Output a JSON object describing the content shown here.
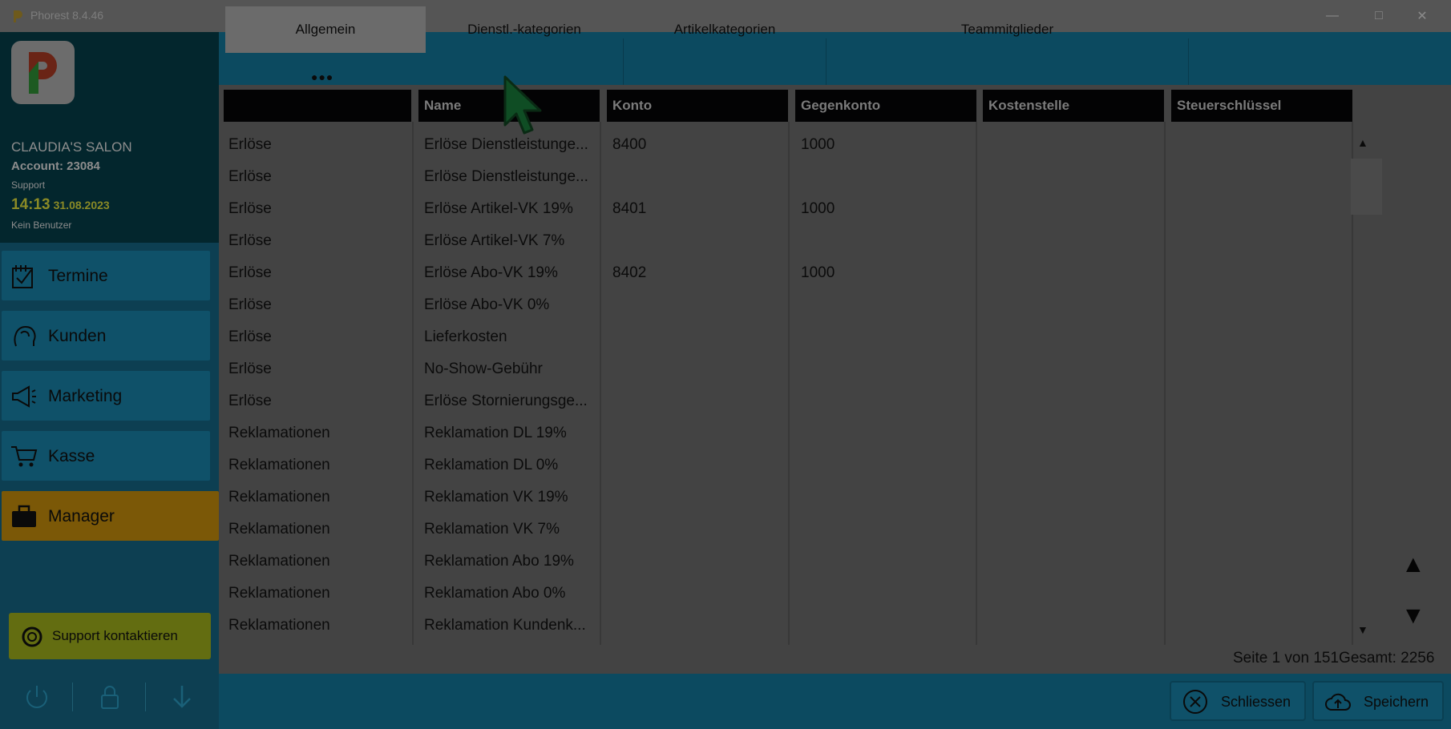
{
  "window": {
    "title": "Phorest 8.4.46"
  },
  "sidebar": {
    "salon_name": "CLAUDIA'S SALON",
    "account": "Account: 23084",
    "support_label": "Support",
    "time": "14:13",
    "date": "31.08.2023",
    "user": "Kein Benutzer",
    "nav": [
      {
        "label": "Termine",
        "icon": "calendar-icon"
      },
      {
        "label": "Kunden",
        "icon": "customer-head-icon"
      },
      {
        "label": "Marketing",
        "icon": "megaphone-icon"
      },
      {
        "label": "Kasse",
        "icon": "cart-icon"
      },
      {
        "label": "Manager",
        "icon": "briefcase-icon",
        "active": true
      }
    ],
    "support_button": "Support kontaktieren"
  },
  "tabs": [
    {
      "label": "Allgemein",
      "active": true
    },
    {
      "label": "Dienstl.-kategorien"
    },
    {
      "label": "Artikelkategorien"
    },
    {
      "label": "Teammitglieder"
    }
  ],
  "table": {
    "headers": [
      "",
      "Name",
      "Konto",
      "Gegenkonto",
      "Kostenstelle",
      "Steuerschlüssel"
    ],
    "rows": [
      [
        "Erlöse",
        "Erlöse Dienstleistunge...",
        "8400",
        "1000",
        "",
        ""
      ],
      [
        "Erlöse",
        "Erlöse Dienstleistunge...",
        "",
        "",
        "",
        ""
      ],
      [
        "Erlöse",
        "Erlöse Artikel-VK 19%",
        "8401",
        "1000",
        "",
        ""
      ],
      [
        "Erlöse",
        "Erlöse Artikel-VK 7%",
        "",
        "",
        "",
        ""
      ],
      [
        "Erlöse",
        "Erlöse Abo-VK 19%",
        "8402",
        "1000",
        "",
        ""
      ],
      [
        "Erlöse",
        "Erlöse Abo-VK 0%",
        "",
        "",
        "",
        ""
      ],
      [
        "Erlöse",
        "Lieferkosten",
        "",
        "",
        "",
        ""
      ],
      [
        "Erlöse",
        "No-Show-Gebühr",
        "",
        "",
        "",
        ""
      ],
      [
        "Erlöse",
        "Erlöse Stornierungsge...",
        "",
        "",
        "",
        ""
      ],
      [
        "Reklamationen",
        "Reklamation DL 19%",
        "",
        "",
        "",
        ""
      ],
      [
        "Reklamationen",
        "Reklamation DL 0%",
        "",
        "",
        "",
        ""
      ],
      [
        "Reklamationen",
        "Reklamation VK 19%",
        "",
        "",
        "",
        ""
      ],
      [
        "Reklamationen",
        "Reklamation VK 7%",
        "",
        "",
        "",
        ""
      ],
      [
        "Reklamationen",
        "Reklamation Abo 19%",
        "",
        "",
        "",
        ""
      ],
      [
        "Reklamationen",
        "Reklamation Abo 0%",
        "",
        "",
        "",
        ""
      ],
      [
        "Reklamationen",
        "Reklamation Kundenk...",
        "",
        "",
        "",
        ""
      ]
    ]
  },
  "pager": {
    "text": "Seite 1 von 151Gesamt: 2256"
  },
  "footer": {
    "close_label": "Schliessen",
    "save_label": "Speichern"
  },
  "colors": {
    "overlay_dim": "#434343",
    "teal": "#0c4a60",
    "manager_active": "#7b5807",
    "support_green": "#636d11"
  }
}
